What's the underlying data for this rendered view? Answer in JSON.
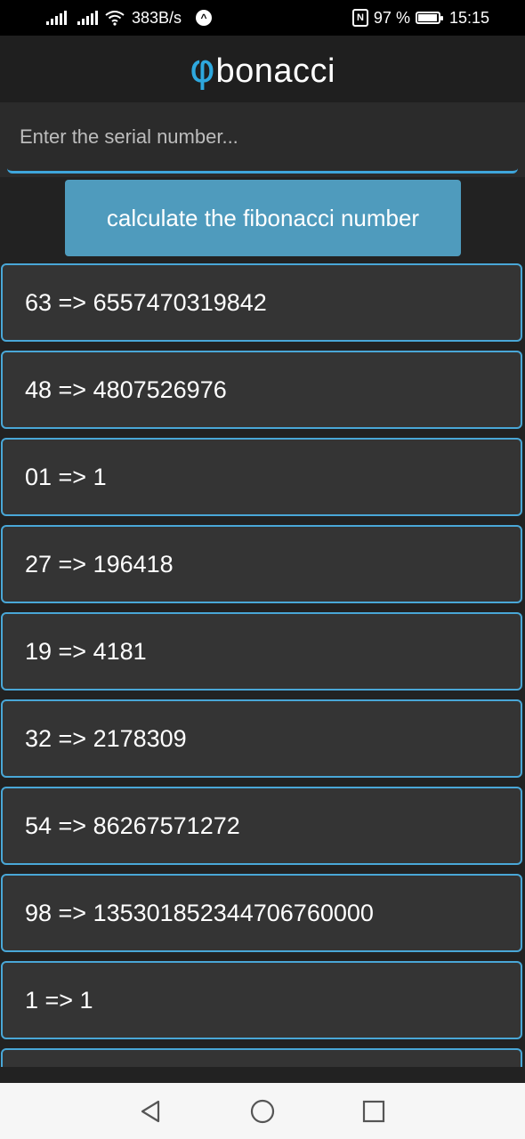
{
  "status_bar": {
    "network_speed": "383B/s",
    "battery_percent": "97 %",
    "battery_level": 0.97,
    "time": "15:15",
    "icons": [
      "signal-icon",
      "signal-icon",
      "wifi-icon",
      "app-notification-icon",
      "nfc-icon",
      "battery-icon"
    ]
  },
  "header": {
    "logo_symbol": "φ",
    "title_rest": "bonacci"
  },
  "input": {
    "placeholder": "Enter the serial number...",
    "value": ""
  },
  "calculate_button": {
    "label": "calculate the fibonacci number"
  },
  "results": [
    "63 => 6557470319842",
    "48 => 4807526976",
    "01 => 1",
    "27 => 196418",
    "19 => 4181",
    "32 => 2178309",
    "54 => 86267571272",
    "98 => 135301852344706760000",
    "1 => 1",
    ""
  ],
  "nav_bar": {
    "icons": [
      "back-icon",
      "home-icon",
      "recents-icon"
    ]
  },
  "colors": {
    "accent": "#3ea6dc",
    "button": "#4f9bbd",
    "background": "#222222",
    "card": "#343434"
  }
}
